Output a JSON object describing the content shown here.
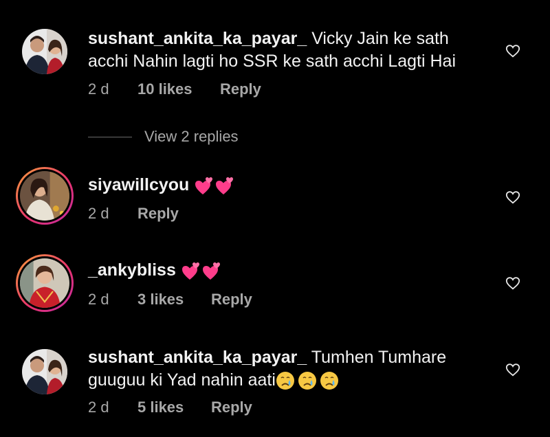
{
  "comments": [
    {
      "username": "sushant_ankita_ka_payar_",
      "text": "Vicky Jain ke sath acchi Nahin lagti ho SSR ke sath acchi Lagti Hai",
      "time": "2 d",
      "likes": "10 likes",
      "reply": "Reply",
      "has_story_ring": false,
      "avatar_icon": "couple-photo"
    },
    {
      "username": "siyawillcyou",
      "text": "",
      "emojis": [
        "two-hearts",
        "two-hearts"
      ],
      "time": "2 d",
      "likes": "",
      "reply": "Reply",
      "has_story_ring": true,
      "avatar_icon": "woman-photo"
    },
    {
      "username": "_ankybliss",
      "text": "",
      "emojis": [
        "two-hearts",
        "two-hearts"
      ],
      "time": "2 d",
      "likes": "3 likes",
      "reply": "Reply",
      "has_story_ring": true,
      "avatar_icon": "woman-red-dress-photo"
    },
    {
      "username": "sushant_ankita_ka_payar_",
      "text": "Tumhen Tumhare guuguu ki Yad nahin aati",
      "emojis": [
        "crying-face",
        "crying-face",
        "crying-face"
      ],
      "time": "2 d",
      "likes": "5 likes",
      "reply": "Reply",
      "has_story_ring": false,
      "avatar_icon": "couple-photo"
    }
  ],
  "view_replies": "View 2 replies",
  "colors": {
    "background": "#000000",
    "text": "#f2f2f2",
    "meta": "#a8a8a8",
    "story_ring": [
      "#f8a13b",
      "#e8346b",
      "#c32aa3"
    ]
  }
}
